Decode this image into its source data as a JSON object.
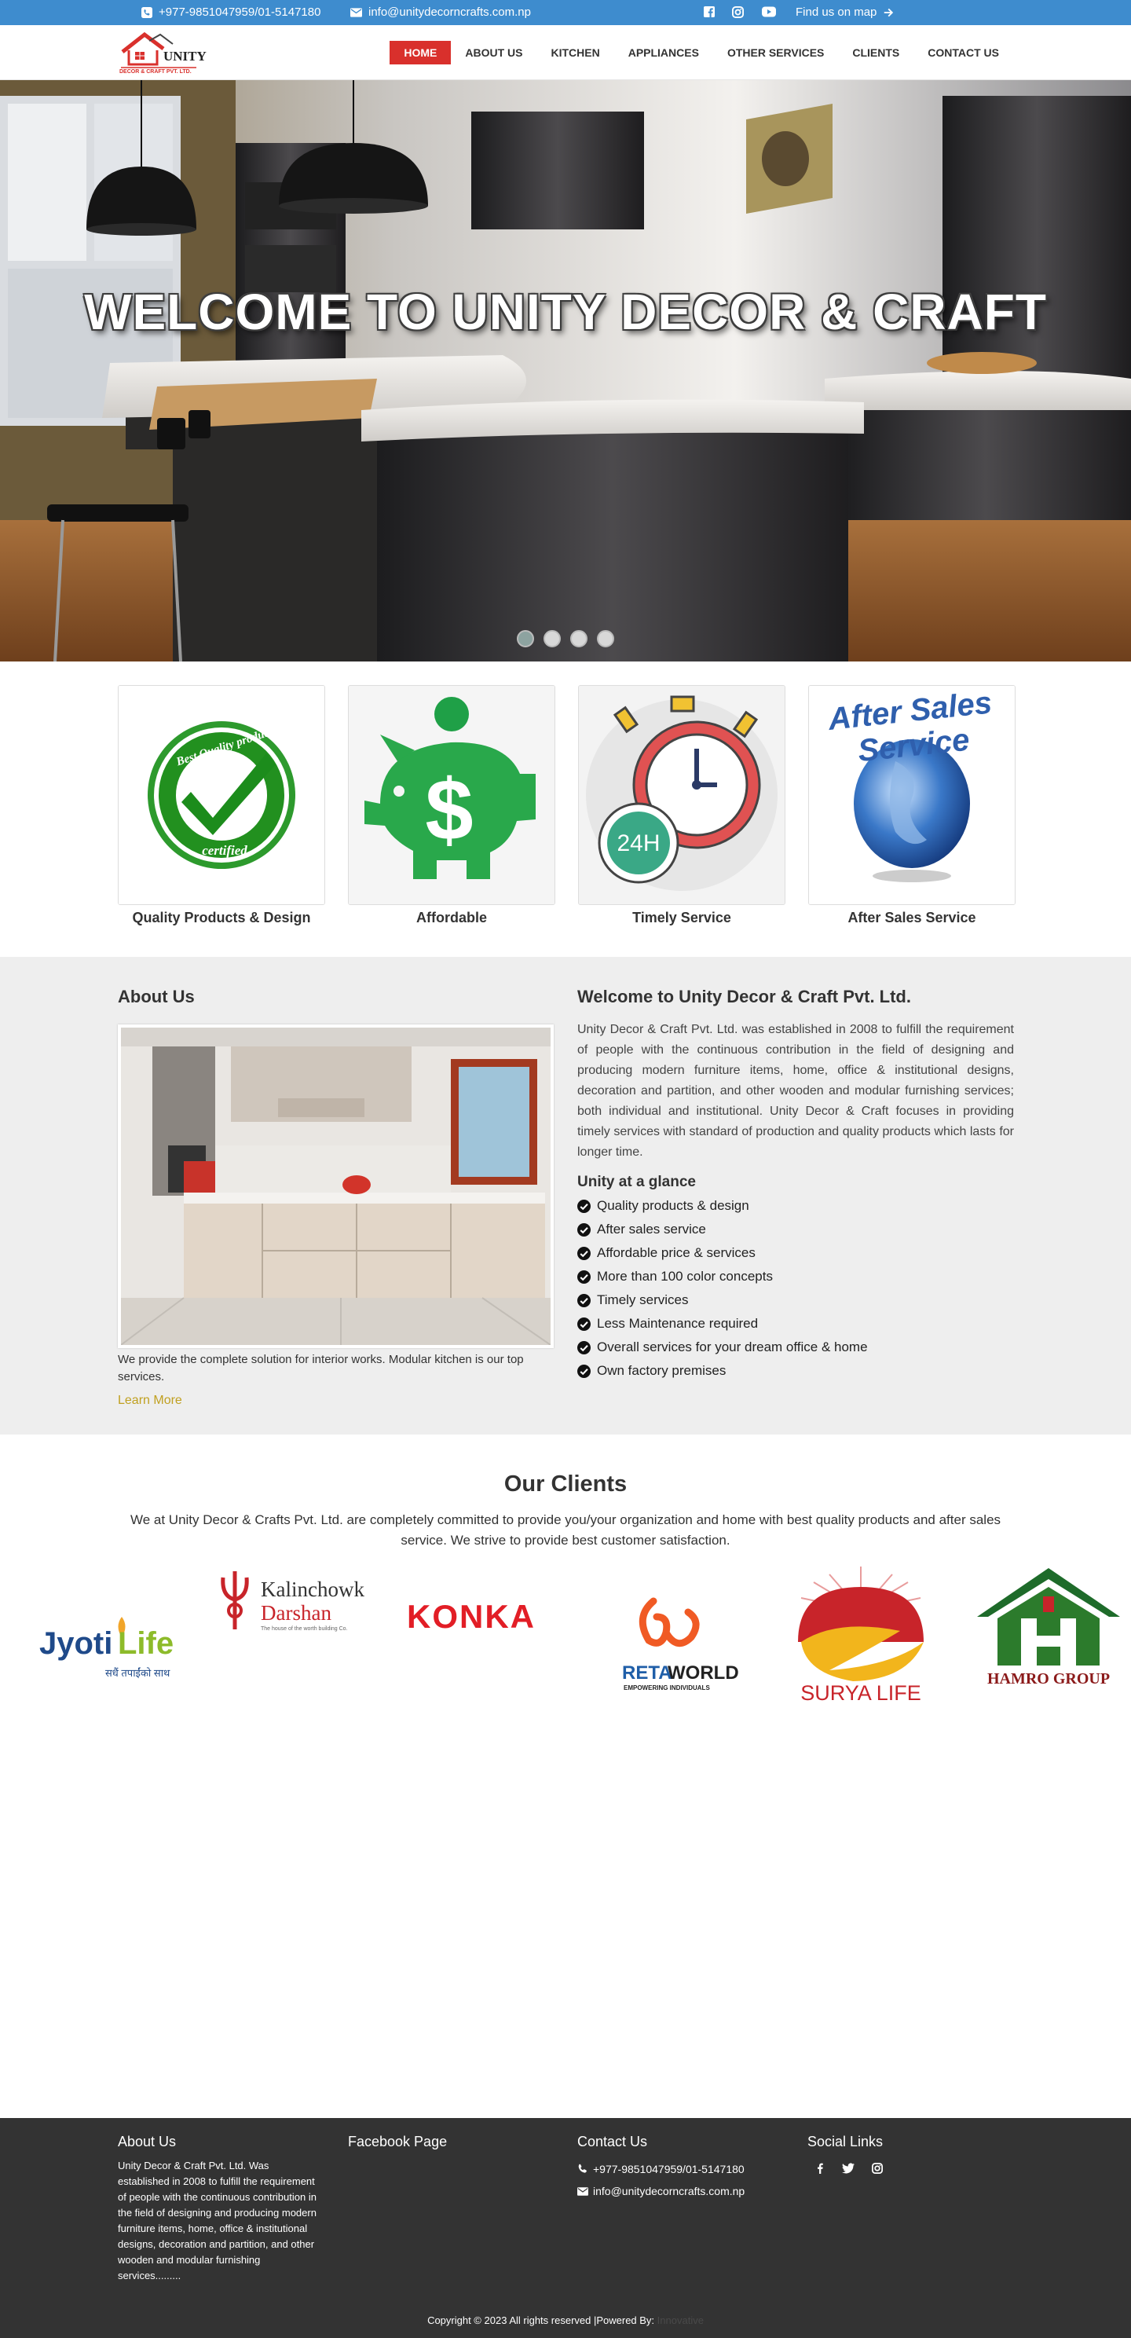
{
  "topbar": {
    "phone": "+977-9851047959/01-5147180",
    "email": "info@unitydecorncrafts.com.np",
    "map_label": "Find us on map",
    "bg_color": "#3e8cce"
  },
  "logo": {
    "brand": "UNITY",
    "sub": "DECOR & CRAFT PVT. LTD."
  },
  "nav": {
    "items": [
      {
        "label": "HOME"
      },
      {
        "label": "ABOUT US"
      },
      {
        "label": "KITCHEN"
      },
      {
        "label": "APPLIANCES"
      },
      {
        "label": "OTHER SERVICES"
      },
      {
        "label": "CLIENTS"
      },
      {
        "label": "CONTACT US"
      }
    ],
    "active_color": "#d9302c"
  },
  "hero": {
    "title": "WELCOME TO UNITY DECOR & CRAFT",
    "slide_count": 4,
    "active_slide": 1
  },
  "features": [
    {
      "caption": "Quality Products & Design",
      "badge_top": "Best Quality product",
      "badge_bottom": "certified"
    },
    {
      "caption": "Affordable"
    },
    {
      "caption": "Timely Service",
      "badge": "24H"
    },
    {
      "caption": "After Sales Service",
      "arc_text": "After Sales Service"
    }
  ],
  "about": {
    "heading": "About Us",
    "text": "We provide the complete solution for interior works. Modular kitchen is our top services.",
    "learn_more": "Learn More",
    "welcome_heading": "Welcome to Unity Decor & Craft Pvt. Ltd.",
    "welcome_text": "Unity Decor & Craft Pvt. Ltd. was established in 2008 to fulfill the requirement of people with the continuous contribution in the field of designing and producing modern furniture items, home, office & institutional designs, decoration and partition, and other wooden and modular furnishing services; both individual and institutional. Unity Decor & Craft focuses in providing timely services with standard of production and quality products which lasts for longer time.",
    "glance_heading": "Unity at a glance",
    "glance_items": [
      "Quality products & design",
      "After sales service",
      "Affordable price & services",
      "More than 100 color concepts",
      "Timely services",
      "Less Maintenance required",
      "Overall services for your dream office & home",
      "Own factory premises"
    ]
  },
  "clients": {
    "heading": "Our Clients",
    "text": "We at Unity Decor & Crafts Pvt. Ltd. are completely committed to provide you/your organization and home with best quality products and after sales service. We strive to provide best customer satisfaction.",
    "logos": {
      "jyoti": {
        "name1": "Jyoti",
        "name2": "Life",
        "tag": "सधैं तपाईंको साथ"
      },
      "kalinchowk": {
        "name1": "Kalinchowk",
        "name2": "Darshan",
        "tag": "The house of the worth building Co."
      },
      "konka": {
        "name": "KONKA"
      },
      "reta": {
        "name1": "RETA",
        "name2": "WORLD",
        "tag": "EMPOWERING INDIVIDUALS"
      },
      "surya": {
        "name": "SURYA LIFE"
      },
      "hamro": {
        "name": "HAMRO GROUP"
      }
    }
  },
  "footer": {
    "about_heading": "About Us",
    "about_text": "Unity Decor & Craft Pvt. Ltd. Was established in 2008 to fulfill the requirement of people with the continuous contribution in the field of designing and producing modern furniture items, home, office & institutional designs, decoration and partition, and other wooden and modular furnishing services.........",
    "facebook_heading": "Facebook Page",
    "contact_heading": "Contact Us",
    "phone": "+977-9851047959/01-5147180",
    "email": "info@unitydecorncrafts.com.np",
    "social_heading": "Social Links",
    "copyright": "Copyright © 2023 All rights reserved |Powered By:",
    "powered_by": "Innovative",
    "bg_color": "#333333"
  }
}
